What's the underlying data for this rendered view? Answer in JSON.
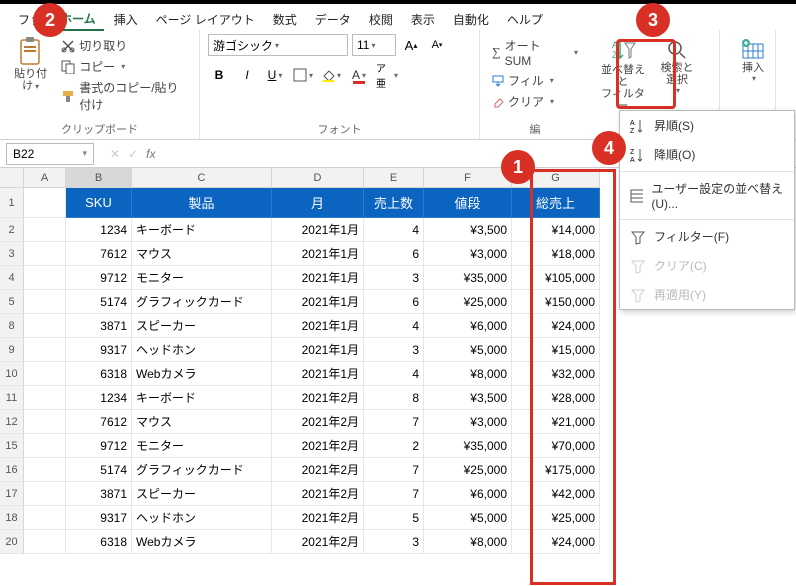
{
  "tabs": {
    "file": "ファ",
    "home": "ホーム",
    "insert": "挿入",
    "pagelayout": "ページ レイアウト",
    "formulas": "数式",
    "data": "データ",
    "review": "校閲",
    "view": "表示",
    "automate": "自動化",
    "help": "ヘルプ"
  },
  "ribbon": {
    "paste_label": "貼り付け",
    "cut": "切り取り",
    "copy": "コピー",
    "formatpainter": "書式のコピー/貼り付け",
    "clipboard_group": "クリップボード",
    "font_name": "游ゴシック",
    "font_size": "11",
    "font_group": "フォント",
    "autosum": "オート SUM",
    "fill": "フィル",
    "clear": "クリア",
    "edit_group": "編",
    "sortfilter": "並べ替えと\nフィルター",
    "findselect": "検索と\n選択",
    "insert_btn": "挿入"
  },
  "menu": {
    "asc": "昇順(S)",
    "desc": "降順(O)",
    "custom": "ユーザー設定の並べ替え(U)...",
    "filter": "フィルター(F)",
    "clear": "クリア(C)",
    "reapply": "再適用(Y)"
  },
  "namebox": "B22",
  "columns": [
    "",
    "A",
    "B",
    "C",
    "D",
    "E",
    "F",
    "G"
  ],
  "headers": {
    "sku": "SKU",
    "product": "製品",
    "month": "月",
    "units": "売上数",
    "price": "値段",
    "total": "総売上"
  },
  "rows": [
    {
      "n": "2",
      "sku": "1234",
      "product": "キーボード",
      "month": "2021年1月",
      "units": "4",
      "price": "¥3,500",
      "total": "¥14,000"
    },
    {
      "n": "3",
      "sku": "7612",
      "product": "マウス",
      "month": "2021年1月",
      "units": "6",
      "price": "¥3,000",
      "total": "¥18,000"
    },
    {
      "n": "4",
      "sku": "9712",
      "product": "モニター",
      "month": "2021年1月",
      "units": "3",
      "price": "¥35,000",
      "total": "¥105,000"
    },
    {
      "n": "5",
      "sku": "5174",
      "product": "グラフィックカード",
      "month": "2021年1月",
      "units": "6",
      "price": "¥25,000",
      "total": "¥150,000"
    },
    {
      "n": "8",
      "sku": "3871",
      "product": "スピーカー",
      "month": "2021年1月",
      "units": "4",
      "price": "¥6,000",
      "total": "¥24,000"
    },
    {
      "n": "9",
      "sku": "9317",
      "product": "ヘッドホン",
      "month": "2021年1月",
      "units": "3",
      "price": "¥5,000",
      "total": "¥15,000"
    },
    {
      "n": "10",
      "sku": "6318",
      "product": "Webカメラ",
      "month": "2021年1月",
      "units": "4",
      "price": "¥8,000",
      "total": "¥32,000"
    },
    {
      "n": "11",
      "sku": "1234",
      "product": "キーボード",
      "month": "2021年2月",
      "units": "8",
      "price": "¥3,500",
      "total": "¥28,000"
    },
    {
      "n": "12",
      "sku": "7612",
      "product": "マウス",
      "month": "2021年2月",
      "units": "7",
      "price": "¥3,000",
      "total": "¥21,000"
    },
    {
      "n": "15",
      "sku": "9712",
      "product": "モニター",
      "month": "2021年2月",
      "units": "2",
      "price": "¥35,000",
      "total": "¥70,000"
    },
    {
      "n": "16",
      "sku": "5174",
      "product": "グラフィックカード",
      "month": "2021年2月",
      "units": "7",
      "price": "¥25,000",
      "total": "¥175,000"
    },
    {
      "n": "17",
      "sku": "3871",
      "product": "スピーカー",
      "month": "2021年2月",
      "units": "7",
      "price": "¥6,000",
      "total": "¥42,000"
    },
    {
      "n": "18",
      "sku": "9317",
      "product": "ヘッドホン",
      "month": "2021年2月",
      "units": "5",
      "price": "¥5,000",
      "total": "¥25,000"
    },
    {
      "n": "20",
      "sku": "6318",
      "product": "Webカメラ",
      "month": "2021年2月",
      "units": "3",
      "price": "¥8,000",
      "total": "¥24,000"
    }
  ],
  "callouts": {
    "c1": "1",
    "c2": "2",
    "c3": "3",
    "c4": "4"
  }
}
